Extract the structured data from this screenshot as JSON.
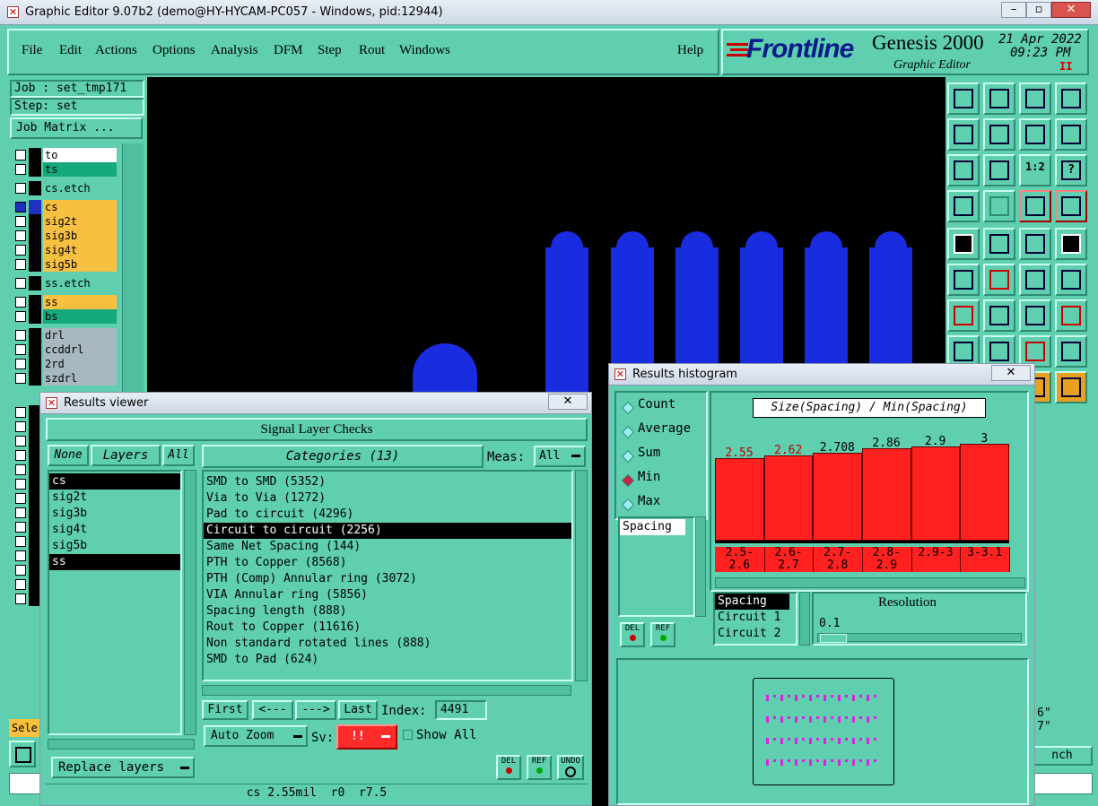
{
  "window": {
    "title": "Graphic Editor 9.07b2 (demo@HY-HYCAM-PC057 - Windows, pid:12944)"
  },
  "menu": [
    "File",
    "Edit",
    "Actions",
    "Options",
    "Analysis",
    "DFM",
    "Step",
    "Rout",
    "Windows"
  ],
  "help": "Help",
  "brand": {
    "logo": "Frontline",
    "product": "Genesis 2000",
    "subtitle": "Graphic Editor",
    "date": "21 Apr 2022",
    "time": "09:23 PM",
    "pause": "II"
  },
  "job": {
    "job_label": "Job : set_tmp171",
    "step_label": "Step: set",
    "matrix_button": "Job Matrix ..."
  },
  "layers": [
    {
      "name": "to",
      "color": "#ffffff"
    },
    {
      "name": "ts",
      "color": "#16a97c"
    },
    {
      "name": "cs.etch",
      "color": "#5fcfb0"
    },
    {
      "name": "cs",
      "color": "#f8c040"
    },
    {
      "name": "sig2t",
      "color": "#f8c040"
    },
    {
      "name": "sig3b",
      "color": "#f8c040"
    },
    {
      "name": "sig4t",
      "color": "#f8c040"
    },
    {
      "name": "sig5b",
      "color": "#f8c040"
    },
    {
      "name": "ss.etch",
      "color": "#5fcfb0"
    },
    {
      "name": "ss",
      "color": "#f8c040"
    },
    {
      "name": "bs",
      "color": "#16a97c"
    },
    {
      "name": "drl",
      "color": "#a8b8c0"
    },
    {
      "name": "ccddrl",
      "color": "#a8b8c0"
    },
    {
      "name": "2rd",
      "color": "#a8b8c0"
    },
    {
      "name": "szdrl",
      "color": "#a8b8c0"
    }
  ],
  "left_bottom": {
    "sele": "Sele"
  },
  "right_edge": {
    "v1": "6\"",
    "v2": "7\"",
    "btn": "nch"
  },
  "results_viewer": {
    "title": "Results viewer",
    "heading": "Signal Layer Checks",
    "none_btn": "None",
    "layers_label": "Layers",
    "all_btn": "All",
    "categories_label": "Categories (13)",
    "meas_label": "Meas:",
    "meas_value": "All",
    "layers_list": [
      "cs",
      "sig2t",
      "sig3b",
      "sig4t",
      "sig5b",
      "ss"
    ],
    "categories": [
      "SMD to SMD (5352)",
      "Via to Via (1272)",
      "Pad to circuit (4296)",
      "Circuit to circuit (2256)",
      "Same Net Spacing (144)",
      "PTH to Copper (8568)",
      "PTH (Comp) Annular ring (3072)",
      "VIA Annular ring (5856)",
      "Spacing length (888)",
      "Rout to Copper (11616)",
      "Non standard rotated lines (888)",
      "SMD to Pad (624)"
    ],
    "first_btn": "First",
    "prev_btn": "<---",
    "next_btn": "--->",
    "last_btn": "Last",
    "index_label": "Index:",
    "index_value": "4491",
    "auto_zoom": "Auto Zoom",
    "sv_label": "Sv:",
    "sv_value": "!!",
    "show_all": "Show All",
    "replace_layers": "Replace layers",
    "del": "DEL",
    "ref": "REF",
    "undo": "UNDO",
    "status": "cs 2.55mil  r0  r7.5"
  },
  "histogram": {
    "title": "Results histogram",
    "modes": [
      "Count",
      "Average",
      "Sum",
      "Min",
      "Max"
    ],
    "selected_mode": "Min",
    "meas_list": [
      "Spacing"
    ],
    "header": "Size(Spacing) / Min(Spacing)",
    "del": "DEL",
    "ref": "REF",
    "fields_list": [
      "Spacing",
      "Circuit 1",
      "Circuit 2"
    ],
    "resolution_label": "Resolution",
    "resolution_value": "0.1",
    "colors": {
      "bar": "#ff2020",
      "low_label": "#c00000"
    }
  },
  "chart_data": {
    "type": "bar",
    "categories": [
      "2.5-2.6",
      "2.6-2.7",
      "2.7-2.8",
      "2.8-2.9",
      "2.9-3",
      "3-3.1"
    ],
    "values": [
      2.55,
      2.62,
      2.708,
      2.86,
      2.9,
      3
    ],
    "labels": [
      "2.55",
      "2.62",
      "2.708",
      "2.86",
      "2.9",
      "3"
    ],
    "ylim": [
      0,
      3.6
    ]
  }
}
